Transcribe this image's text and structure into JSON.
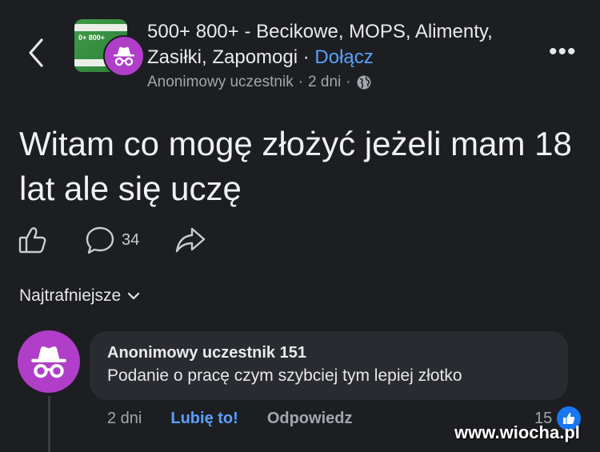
{
  "header": {
    "group_name": "500+ 800+ - Becikowe, MOPS, Alimenty, Zasiłki, Zapomogi",
    "separator": "·",
    "join_label": "Dołącz",
    "thumb_text": "0+ 800+",
    "author": "Anonimowy uczestnik",
    "time": "2 dni",
    "more_label": "•••"
  },
  "post": {
    "text": "Witam co mogę złożyć jeżeli mam 18 lat ale się uczę",
    "comment_count": "34"
  },
  "sort": {
    "label": "Najtrafniejsze"
  },
  "comment": {
    "author": "Anonimowy uczestnik 151",
    "text": "Podanie o pracę czym szybciej tym lepiej złotko",
    "time": "2 dni",
    "like_label": "Lubię to!",
    "reply_label": "Odpowiedz",
    "reaction_count": "15"
  },
  "watermark": "www.wiocha.pl",
  "colors": {
    "background": "#1d1e22",
    "accent": "#5aa0ff",
    "avatar": "#b03ec9",
    "bubble": "#2a2b30"
  }
}
